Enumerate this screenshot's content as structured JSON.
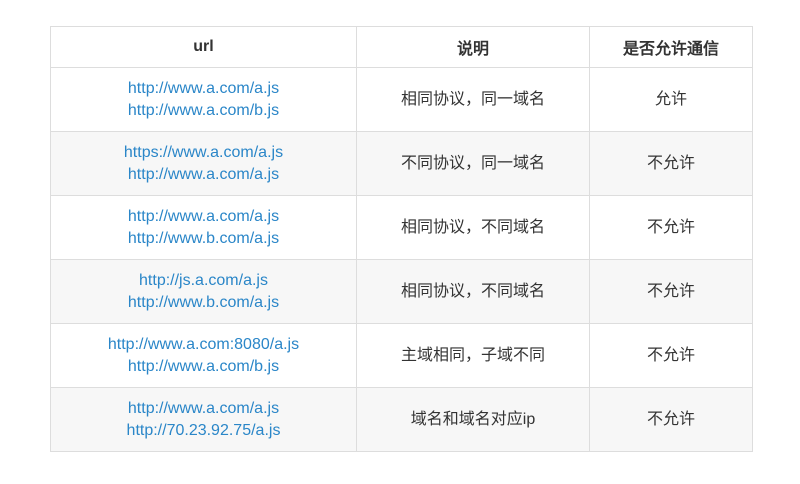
{
  "table": {
    "headers": [
      "url",
      "说明",
      "是否允许通信"
    ],
    "rows": [
      {
        "urls": [
          "http://www.a.com/a.js",
          "http://www.a.com/b.js"
        ],
        "desc": "相同协议，同一域名",
        "allowed": "允许"
      },
      {
        "urls": [
          "https://www.a.com/a.js",
          "http://www.a.com/a.js"
        ],
        "desc": "不同协议，同一域名",
        "allowed": "不允许"
      },
      {
        "urls": [
          "http://www.a.com/a.js",
          "http://www.b.com/a.js"
        ],
        "desc": "相同协议，不同域名",
        "allowed": "不允许"
      },
      {
        "urls": [
          "http://js.a.com/a.js",
          "http://www.b.com/a.js"
        ],
        "desc": "相同协议，不同域名",
        "allowed": "不允许"
      },
      {
        "urls": [
          "http://www.a.com:8080/a.js",
          "http://www.a.com/b.js"
        ],
        "desc": "主域相同，子域不同",
        "allowed": "不允许"
      },
      {
        "urls": [
          "http://www.a.com/a.js",
          "http://70.23.92.75/a.js"
        ],
        "desc": "域名和域名对应ip",
        "allowed": "不允许"
      }
    ]
  },
  "colors": {
    "link": "#2a86c8",
    "border": "#dddddd",
    "stripe": "#f7f7f7"
  }
}
